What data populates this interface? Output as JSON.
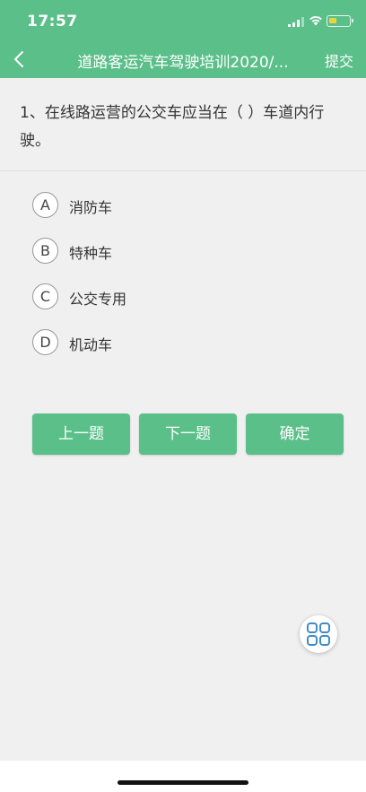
{
  "status_bar": {
    "time": "17:57"
  },
  "nav": {
    "title": "道路客运汽车驾驶培训2020/...",
    "submit_label": "提交"
  },
  "question": {
    "text": "1、在线路运营的公交车应当在（ ）车道内行驶。"
  },
  "options": [
    {
      "letter": "A",
      "label": "消防车"
    },
    {
      "letter": "B",
      "label": "特种车"
    },
    {
      "letter": "C",
      "label": "公交专用"
    },
    {
      "letter": "D",
      "label": "机动车"
    }
  ],
  "buttons": {
    "prev_label": "上一题",
    "next_label": "下一题",
    "confirm_label": "确定"
  },
  "icons": {
    "back": "chevron-left-icon",
    "grid": "grid-icon",
    "signal": "signal-icon",
    "wifi": "wifi-icon",
    "battery": "battery-icon"
  },
  "colors": {
    "accent": "#5bbf8a",
    "battery": "#f2d13e",
    "background": "#f0f0f0"
  },
  "battery_level": 0.4
}
